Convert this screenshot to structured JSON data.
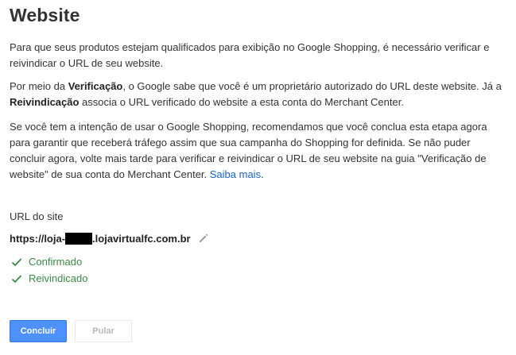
{
  "page": {
    "title": "Website",
    "paragraph1": "Para que seus produtos estejam qualificados para exibição no Google Shopping, é necessário verificar e reivindicar o URL de seu website.",
    "paragraph2": {
      "part1": "Por meio da ",
      "bold1": "Verificação",
      "part2": ", o Google sabe que você é um proprietário autorizado do URL deste website. Já a ",
      "bold2": "Reivindicação",
      "part3": " associa o URL verificado do website a esta conta do Merchant Center."
    },
    "paragraph3": {
      "text": "Se você tem a intenção de usar o Google Shopping, recomendamos que você conclua esta etapa agora para garantir que receberá tráfego assim que sua campanha do Shopping for definida. Se não puder concluir agora, volte mais tarde para verificar e reivindicar o URL de seu website na guia \"Verificação de website\" de sua conta do Merchant Center. ",
      "link": "Saiba mais",
      "suffix": "."
    }
  },
  "site": {
    "label": "URL do site",
    "url_prefix": "https://loja-",
    "url_suffix": ".lojavirtualfc.com.br",
    "edit_icon": "pencil-icon"
  },
  "statuses": [
    {
      "label": "Confirmado",
      "icon": "check-icon"
    },
    {
      "label": "Reivindicado",
      "icon": "check-icon"
    }
  ],
  "buttons": {
    "primary": "Concluir",
    "secondary": "Pular"
  },
  "colors": {
    "primary_button": "#4d90fe",
    "link": "#1a62c7",
    "status_green": "#3a8a44"
  }
}
